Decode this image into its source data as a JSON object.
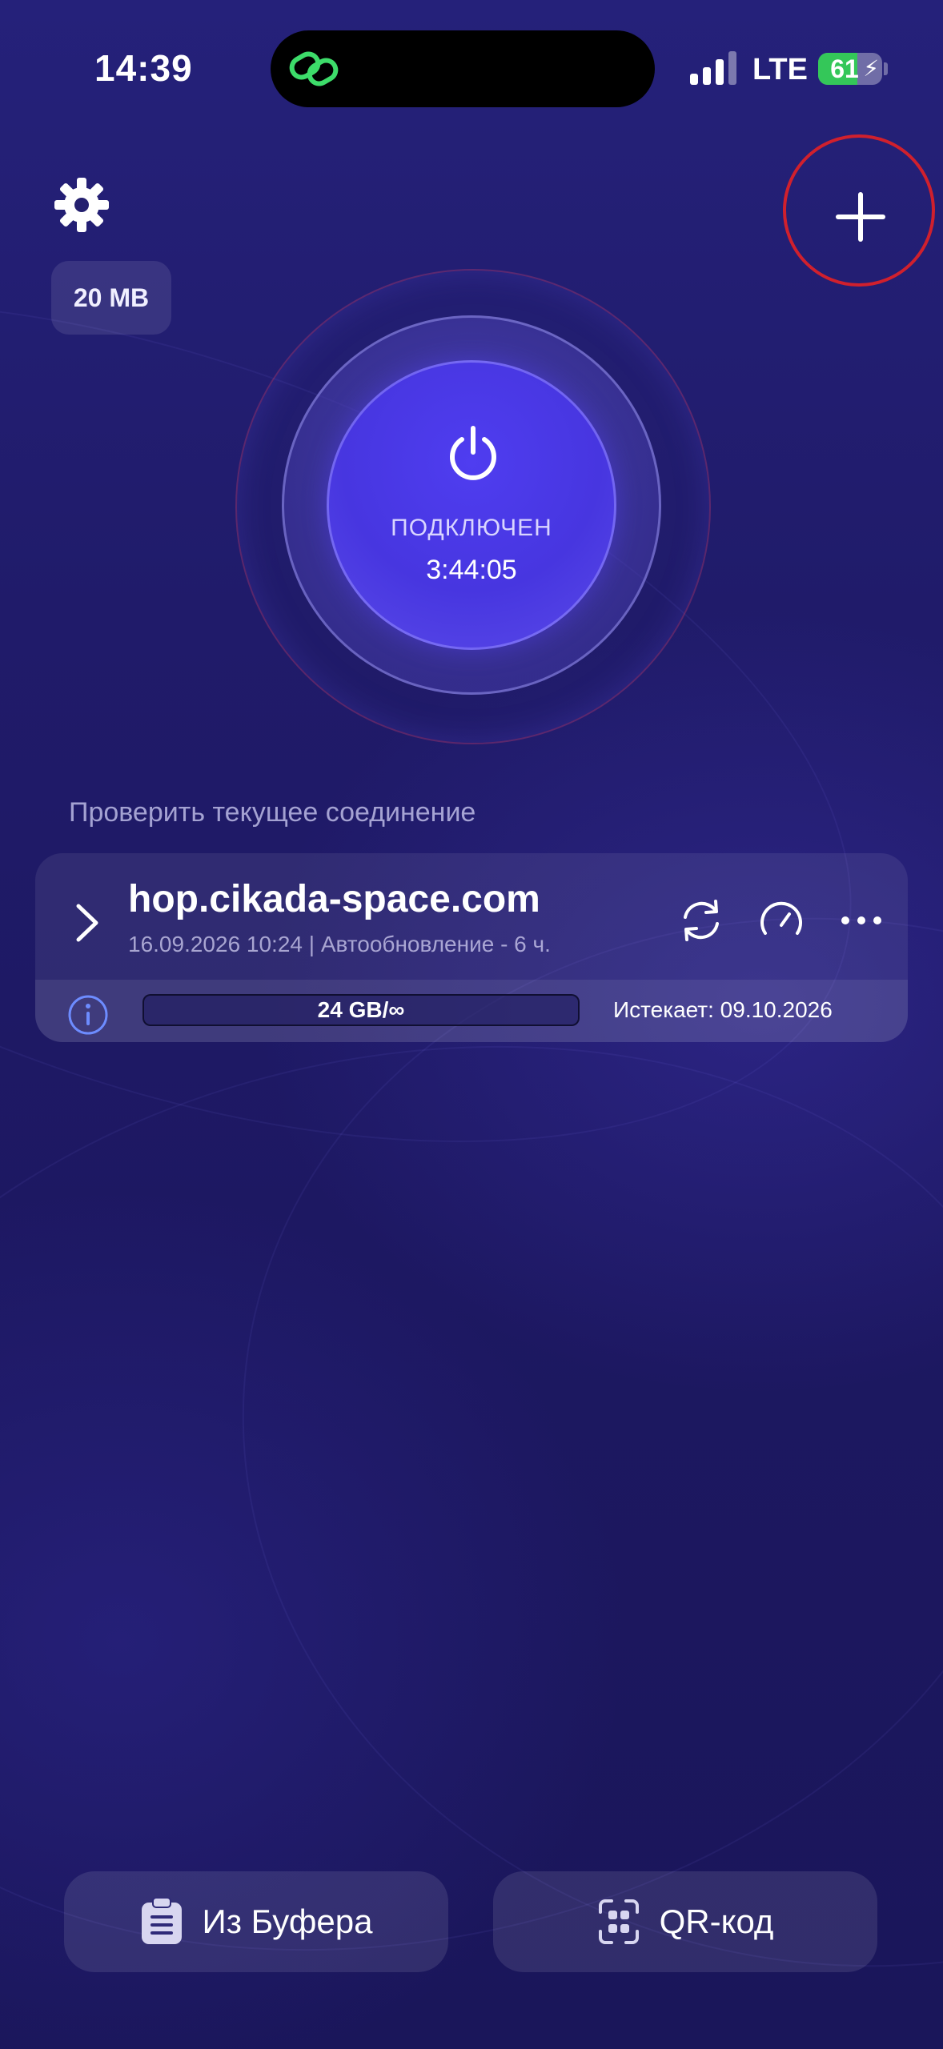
{
  "status_bar": {
    "time": "14:39",
    "network": "LTE",
    "battery_percent": "61",
    "battery_level": 0.61,
    "battery_charging": true,
    "island_app_icon": "link-icon",
    "island_icon_color": "#3ddc6a"
  },
  "top": {
    "settings_icon": "gear-icon",
    "data_usage": "20 MB",
    "add_icon": "plus-icon"
  },
  "connect": {
    "status": "ПОДКЛЮЧЕН",
    "timer": "3:44:05",
    "icon": "power-icon",
    "accent": "#4a38e6"
  },
  "check_connection_label": "Проверить текущее соединение",
  "server": {
    "host": "hop.cikada-space.com",
    "meta": "16.09.2026 10:24 | Автообновление - 6 ч.",
    "actions": [
      "refresh-icon",
      "speedometer-icon",
      "more-icon"
    ],
    "traffic": "24 GB/∞",
    "expires": "Истекает: 09.10.2026"
  },
  "bottom": {
    "clipboard_label": "Из Буфера",
    "qr_label": "QR-код"
  },
  "colors": {
    "background": "#1f1b63",
    "highlight_ring": "#d0202d",
    "info_icon": "#6d8cff"
  }
}
